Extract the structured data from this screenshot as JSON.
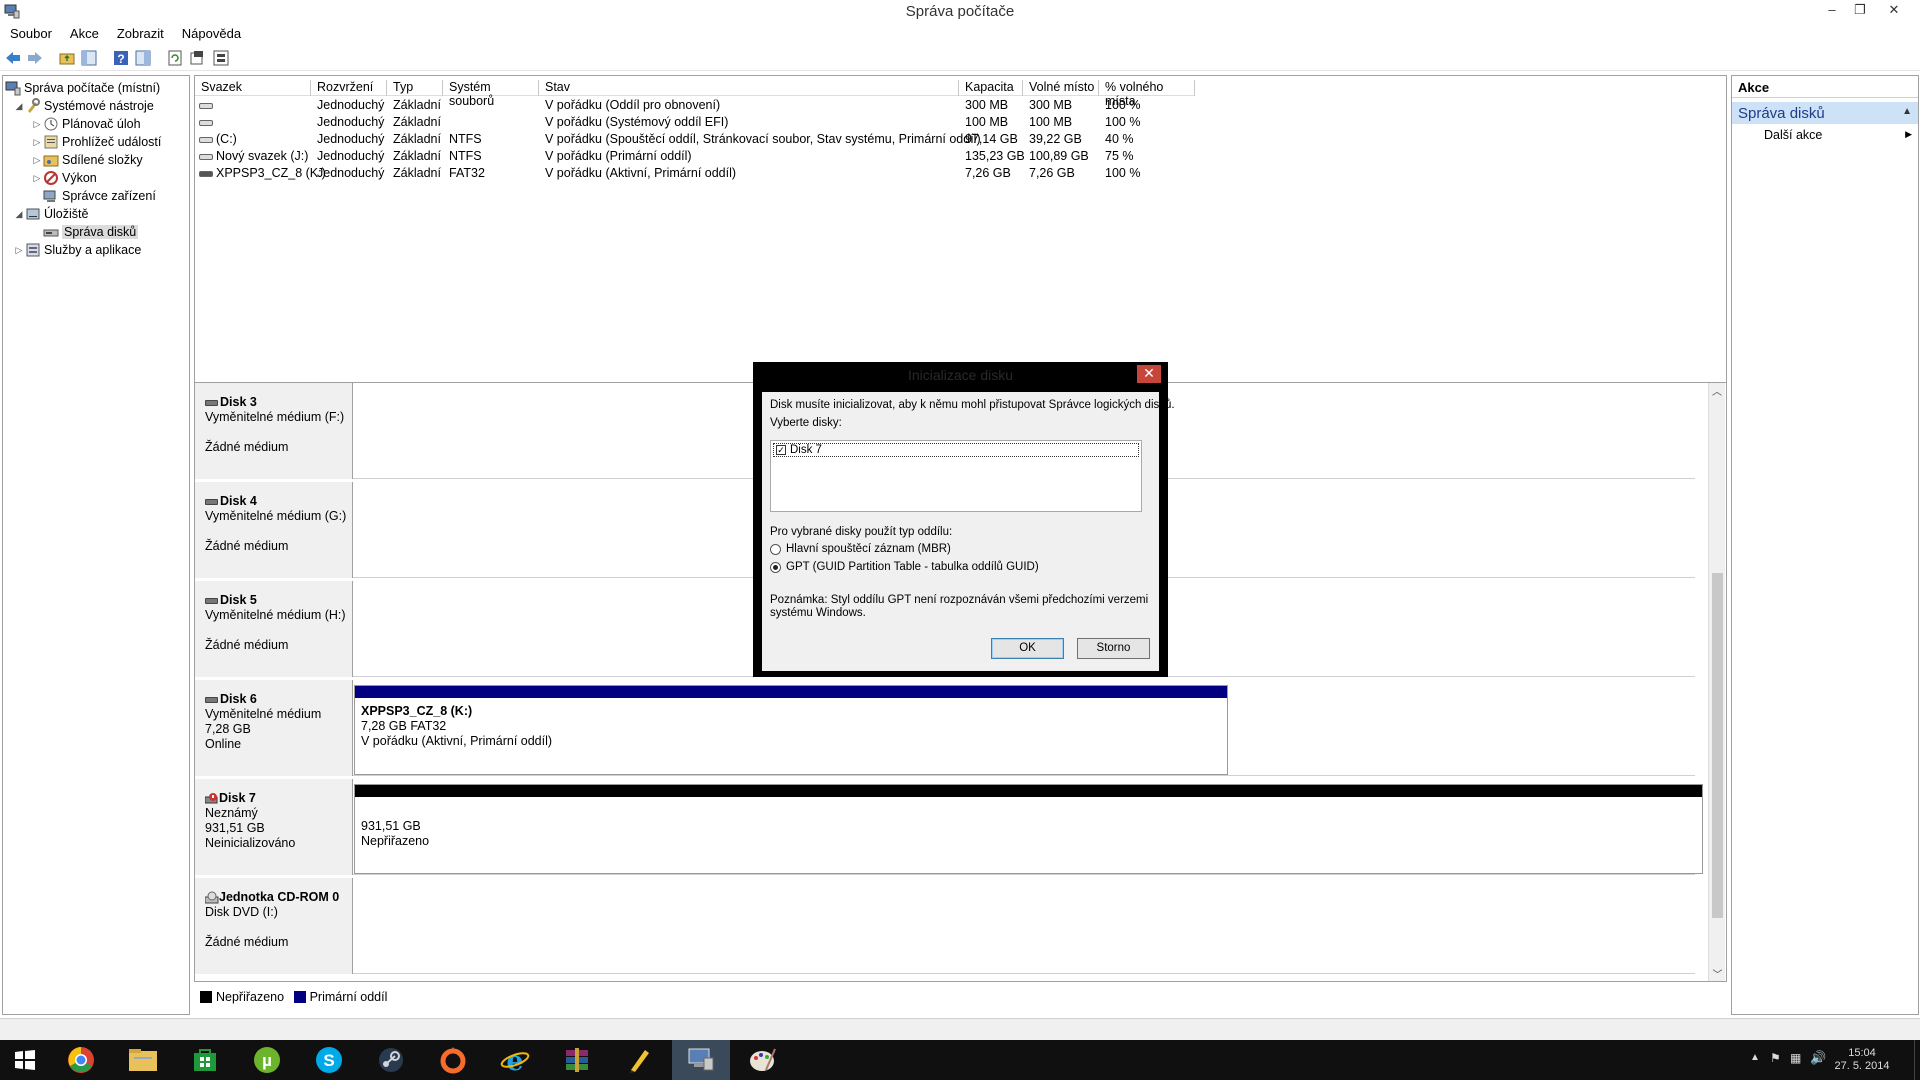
{
  "window": {
    "title": "Správa počítače",
    "minimize": "–",
    "restore": "❐",
    "close": "✕"
  },
  "menu": [
    "Soubor",
    "Akce",
    "Zobrazit",
    "Nápověda"
  ],
  "tree": {
    "root": "Správa počítače (místní)",
    "system_tools": "Systémové nástroje",
    "task_scheduler": "Plánovač úloh",
    "event_viewer": "Prohlížeč událostí",
    "shared_folders": "Sdílené složky",
    "performance": "Výkon",
    "device_manager": "Správce zařízení",
    "storage": "Úložiště",
    "disk_management": "Správa disků",
    "services": "Služby a aplikace"
  },
  "volumes": {
    "columns": [
      "Svazek",
      "Rozvržení",
      "Typ",
      "Systém souborů",
      "Stav",
      "Kapacita",
      "Volné místo",
      "% volného místa"
    ],
    "rows": [
      [
        "",
        "Jednoduchý",
        "Základní",
        "",
        "V pořádku (Oddíl pro obnovení)",
        "300 MB",
        "300 MB",
        "100 %"
      ],
      [
        "",
        "Jednoduchý",
        "Základní",
        "",
        "V pořádku (Systémový oddíl EFI)",
        "100 MB",
        "100 MB",
        "100 %"
      ],
      [
        "(C:)",
        "Jednoduchý",
        "Základní",
        "NTFS",
        "V pořádku (Spouštěcí oddíl, Stránkovací soubor, Stav systému, Primární oddíl)",
        "97,14 GB",
        "39,22 GB",
        "40 %"
      ],
      [
        "Nový svazek (J:)",
        "Jednoduchý",
        "Základní",
        "NTFS",
        "V pořádku (Primární oddíl)",
        "135,23 GB",
        "100,89 GB",
        "75 %"
      ],
      [
        "XPPSP3_CZ_8 (K:)",
        "Jednoduchý",
        "Základní",
        "FAT32",
        "V pořádku (Aktivní, Primární oddíl)",
        "7,26 GB",
        "7,26 GB",
        "100 %"
      ]
    ]
  },
  "disks": [
    {
      "name": "Disk 3",
      "line1": "Vyměnitelné médium (F:)",
      "line2": "",
      "line3": "Žádné médium"
    },
    {
      "name": "Disk 4",
      "line1": "Vyměnitelné médium (G:)",
      "line2": "",
      "line3": "Žádné médium"
    },
    {
      "name": "Disk 5",
      "line1": "Vyměnitelné médium (H:)",
      "line2": "",
      "line3": "Žádné médium"
    },
    {
      "name": "Disk 6",
      "line1": "Vyměnitelné médium",
      "line2": "7,28 GB",
      "line3": "Online",
      "partition": {
        "title": "XPPSP3_CZ_8  (K:)",
        "size": "7,28 GB FAT32",
        "status": "V pořádku (Aktivní, Primární oddíl)"
      }
    },
    {
      "name": "Disk 7",
      "line1": "Neznámý",
      "line2": "931,51 GB",
      "line3": "Neinicializováno",
      "partition": {
        "title": "",
        "size": "931,51 GB",
        "status": "Nepřiřazeno"
      }
    },
    {
      "name": "Jednotka CD-ROM 0",
      "line1": "Disk DVD (I:)",
      "line2": "",
      "line3": "Žádné médium"
    }
  ],
  "legend": {
    "unallocated": "Nepřiřazeno",
    "primary": "Primární oddíl",
    "unallocated_color": "#000000",
    "primary_color": "#000080"
  },
  "actions": {
    "header": "Akce",
    "section": "Správa disků",
    "more": "Další akce"
  },
  "dialog": {
    "title": "Inicializace disku",
    "intro": "Disk musíte inicializovat, aby k němu mohl přistupovat Správce logických disků.",
    "select_label": "Vyberte disky:",
    "disk_item": "Disk 7",
    "partition_label": "Pro vybrané disky použít typ oddílu:",
    "mbr": "Hlavní spouštěcí záznam (MBR)",
    "gpt": "GPT (GUID Partition Table - tabulka oddílů GUID)",
    "note1": "Poznámka: Styl oddílu GPT není rozpoznáván všemi předchozími verzemi",
    "note2": "systému Windows.",
    "ok": "OK",
    "cancel": "Storno"
  },
  "taskbar": {
    "time": "15:04",
    "date": "27. 5. 2014"
  }
}
